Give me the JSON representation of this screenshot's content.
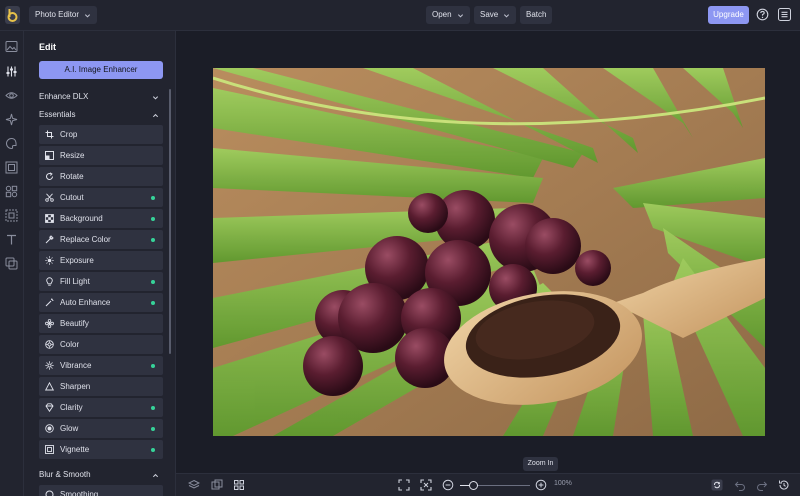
{
  "topbar": {
    "app_dropdown": "Photo Editor",
    "open_label": "Open",
    "save_label": "Save",
    "batch_label": "Batch",
    "upgrade_label": "Upgrade",
    "icons": [
      "logo-icon",
      "chevron-down-icon",
      "help-icon",
      "menu-icon"
    ]
  },
  "rail": {
    "icons": [
      "image-icon",
      "sliders-icon",
      "eye-icon",
      "sparkle-icon",
      "palette-icon",
      "frame-icon",
      "elements-icon",
      "texture-icon",
      "text-icon",
      "graphics-icon"
    ]
  },
  "panel": {
    "title": "Edit",
    "enhancer_label": "A.I. Image Enhancer",
    "sections": {
      "enhance_dlx": "Enhance DLX",
      "essentials": "Essentials",
      "blur_smooth": "Blur & Smooth"
    },
    "tools": [
      {
        "label": "Crop",
        "icon": "crop-icon",
        "premium": false
      },
      {
        "label": "Resize",
        "icon": "resize-icon",
        "premium": false
      },
      {
        "label": "Rotate",
        "icon": "rotate-icon",
        "premium": false
      },
      {
        "label": "Cutout",
        "icon": "scissors-icon",
        "premium": true
      },
      {
        "label": "Background",
        "icon": "checker-icon",
        "premium": true
      },
      {
        "label": "Replace Color",
        "icon": "eyedropper-icon",
        "premium": true
      },
      {
        "label": "Exposure",
        "icon": "sun-icon",
        "premium": false
      },
      {
        "label": "Fill Light",
        "icon": "bulb-icon",
        "premium": true
      },
      {
        "label": "Auto Enhance",
        "icon": "wand-icon",
        "premium": true
      },
      {
        "label": "Beautify",
        "icon": "flower-icon",
        "premium": false
      },
      {
        "label": "Color",
        "icon": "color-wheel-icon",
        "premium": false
      },
      {
        "label": "Vibrance",
        "icon": "vibrance-icon",
        "premium": true
      },
      {
        "label": "Sharpen",
        "icon": "triangle-icon",
        "premium": false
      },
      {
        "label": "Clarity",
        "icon": "diamond-icon",
        "premium": true
      },
      {
        "label": "Glow",
        "icon": "glow-icon",
        "premium": true
      },
      {
        "label": "Vignette",
        "icon": "vignette-icon",
        "premium": true
      }
    ],
    "partial_tool": "Smoothing"
  },
  "bottombar": {
    "zoom_value": "100%",
    "tooltip": "Zoom In",
    "icons": [
      "layers-icon",
      "compare-icon",
      "grid-icon",
      "fit-screen-icon",
      "actual-size-icon",
      "zoom-out-icon",
      "zoom-in-icon",
      "reset-icon",
      "undo-icon",
      "redo-icon",
      "history-icon"
    ]
  },
  "colors": {
    "accent": "#8d97f2",
    "premium_dot": "#36d399",
    "panel_bg": "#22242f",
    "canvas_bg": "#1b1d27"
  }
}
